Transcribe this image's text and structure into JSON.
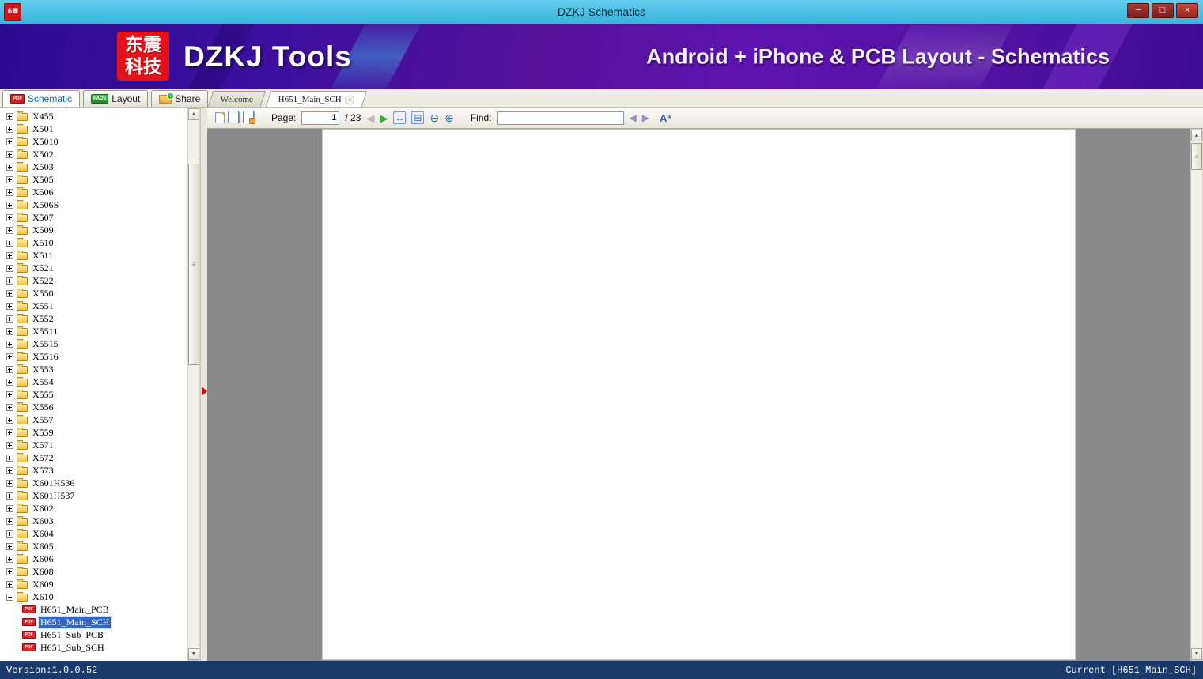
{
  "window": {
    "title": "DZKJ Schematics",
    "app_badge": "东震",
    "controls": {
      "minimize": "−",
      "maximize": "□",
      "close": "×"
    }
  },
  "banner": {
    "logo_top": "东震",
    "logo_bottom": "科技",
    "app_name": "DZKJ Tools",
    "tagline": "Android + iPhone & PCB Layout - Schematics"
  },
  "mode_tabs": [
    {
      "label": "Schematic",
      "icon": "pdf",
      "badge": "PDF",
      "active": true
    },
    {
      "label": "Layout",
      "icon": "pads",
      "badge": "PADS",
      "active": false
    },
    {
      "label": "Share",
      "icon": "share-folder",
      "badge": "+",
      "active": false
    }
  ],
  "doc_tabs": [
    {
      "label": "Welcome",
      "active": false,
      "closable": false,
      "close_glyph": ""
    },
    {
      "label": "H651_Main_SCH",
      "active": true,
      "closable": true,
      "close_glyph": "×"
    }
  ],
  "toolbar": {
    "page_label": "Page:",
    "page_value": "1",
    "page_total": "/ 23",
    "find_label": "Find:",
    "find_value": "",
    "icons": {
      "prev_page": "◀",
      "next_page": "▶",
      "fit_width": "↔",
      "fit_page": "⊞",
      "zoom_out": "⊖",
      "zoom_in": "⊕",
      "find_prev": "◀",
      "find_next": "▶",
      "font_size": "Aª"
    }
  },
  "scrollbar": {
    "up": "▲",
    "down": "▼",
    "grip": "≡"
  },
  "tree": {
    "pdf_badge": "PDF",
    "items": [
      {
        "label": "X455",
        "kind": "folder",
        "state": "collapsed"
      },
      {
        "label": "X501",
        "kind": "folder",
        "state": "collapsed"
      },
      {
        "label": "X5010",
        "kind": "folder",
        "state": "collapsed"
      },
      {
        "label": "X502",
        "kind": "folder",
        "state": "collapsed"
      },
      {
        "label": "X503",
        "kind": "folder",
        "state": "collapsed"
      },
      {
        "label": "X505",
        "kind": "folder",
        "state": "collapsed"
      },
      {
        "label": "X506",
        "kind": "folder",
        "state": "collapsed"
      },
      {
        "label": "X506S",
        "kind": "folder",
        "state": "collapsed"
      },
      {
        "label": "X507",
        "kind": "folder",
        "state": "collapsed"
      },
      {
        "label": "X509",
        "kind": "folder",
        "state": "collapsed"
      },
      {
        "label": "X510",
        "kind": "folder",
        "state": "collapsed"
      },
      {
        "label": "X511",
        "kind": "folder",
        "state": "collapsed"
      },
      {
        "label": "X521",
        "kind": "folder",
        "state": "collapsed"
      },
      {
        "label": "X522",
        "kind": "folder",
        "state": "collapsed"
      },
      {
        "label": "X550",
        "kind": "folder",
        "state": "collapsed"
      },
      {
        "label": "X551",
        "kind": "folder",
        "state": "collapsed"
      },
      {
        "label": "X552",
        "kind": "folder",
        "state": "collapsed"
      },
      {
        "label": "X5511",
        "kind": "folder",
        "state": "collapsed"
      },
      {
        "label": "X5515",
        "kind": "folder",
        "state": "collapsed"
      },
      {
        "label": "X5516",
        "kind": "folder",
        "state": "collapsed"
      },
      {
        "label": "X553",
        "kind": "folder",
        "state": "collapsed"
      },
      {
        "label": "X554",
        "kind": "folder",
        "state": "collapsed"
      },
      {
        "label": "X555",
        "kind": "folder",
        "state": "collapsed"
      },
      {
        "label": "X556",
        "kind": "folder",
        "state": "collapsed"
      },
      {
        "label": "X557",
        "kind": "folder",
        "state": "collapsed"
      },
      {
        "label": "X559",
        "kind": "folder",
        "state": "collapsed"
      },
      {
        "label": "X571",
        "kind": "folder",
        "state": "collapsed"
      },
      {
        "label": "X572",
        "kind": "folder",
        "state": "collapsed"
      },
      {
        "label": "X573",
        "kind": "folder",
        "state": "collapsed"
      },
      {
        "label": "X601H536",
        "kind": "folder",
        "state": "collapsed"
      },
      {
        "label": "X601H537",
        "kind": "folder",
        "state": "collapsed"
      },
      {
        "label": "X602",
        "kind": "folder",
        "state": "collapsed"
      },
      {
        "label": "X603",
        "kind": "folder",
        "state": "collapsed"
      },
      {
        "label": "X604",
        "kind": "folder",
        "state": "collapsed"
      },
      {
        "label": "X605",
        "kind": "folder",
        "state": "collapsed"
      },
      {
        "label": "X606",
        "kind": "folder",
        "state": "collapsed"
      },
      {
        "label": "X608",
        "kind": "folder",
        "state": "collapsed"
      },
      {
        "label": "X609",
        "kind": "folder",
        "state": "collapsed"
      },
      {
        "label": "X610",
        "kind": "folder",
        "state": "expanded"
      },
      {
        "label": "H651_Main_PCB",
        "kind": "pdf",
        "selected": false
      },
      {
        "label": "H651_Main_SCH",
        "kind": "pdf",
        "selected": true
      },
      {
        "label": "H651_Sub_PCB",
        "kind": "pdf",
        "selected": false
      },
      {
        "label": "H651_Sub_SCH",
        "kind": "pdf",
        "selected": false
      }
    ]
  },
  "statusbar": {
    "version": "Version:1.0.0.52",
    "current": "Current [H651_Main_SCH]"
  }
}
